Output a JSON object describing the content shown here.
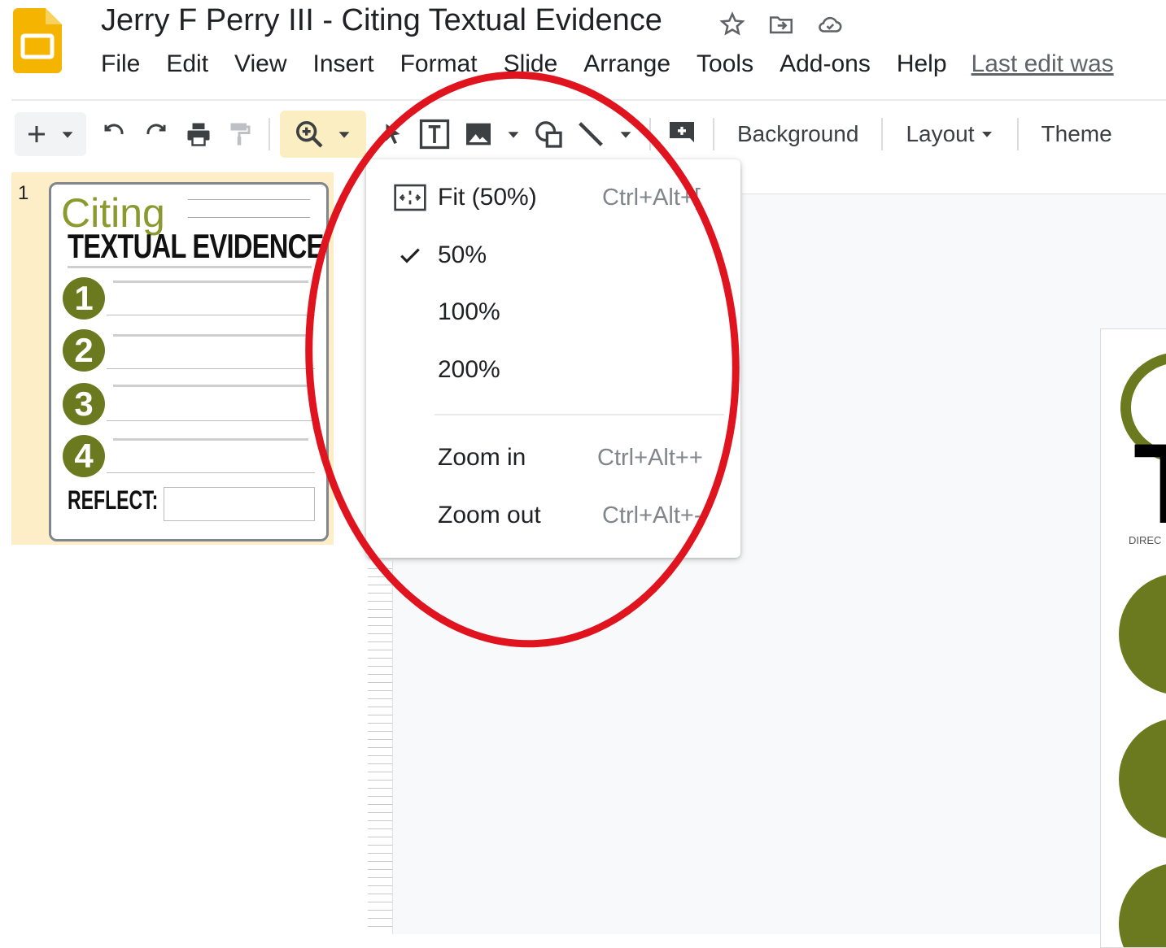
{
  "app": {
    "title": "Jerry F Perry III - Citing Textual Evidence",
    "brand_color": "#f4b400",
    "title_icons": [
      "star-icon",
      "move-to-folder-icon",
      "cloud-saved-icon"
    ]
  },
  "menu": {
    "items": [
      "File",
      "Edit",
      "View",
      "Insert",
      "Format",
      "Slide",
      "Arrange",
      "Tools",
      "Add-ons",
      "Help"
    ],
    "last_edit": "Last edit was"
  },
  "toolbar": {
    "icons": [
      "new-slide-icon",
      "undo-icon",
      "redo-icon",
      "print-icon",
      "paint-format-icon",
      "zoom-icon",
      "select-icon",
      "text-box-icon",
      "image-icon",
      "shape-icon",
      "line-icon",
      "comment-icon"
    ],
    "background_label": "Background",
    "layout_label": "Layout",
    "theme_label": "Theme"
  },
  "filmstrip": {
    "slide_number": "1",
    "thumbnail": {
      "heading_small": "Citing",
      "heading_large": "TEXTUAL EVIDENCE",
      "numbers": [
        "1",
        "2",
        "3",
        "4"
      ],
      "reflect": "REFLECT:"
    }
  },
  "zoom_menu": {
    "items": [
      {
        "label": "Fit (50%)",
        "shortcut": "Ctrl+Alt+[",
        "icon": "fit-icon",
        "checked": false
      },
      {
        "label": "50%",
        "shortcut": "",
        "icon": "",
        "checked": true
      },
      {
        "label": "100%",
        "shortcut": "",
        "icon": "",
        "checked": false
      },
      {
        "label": "200%",
        "shortcut": "",
        "icon": "",
        "checked": false
      },
      {
        "label": "Zoom in",
        "shortcut": "Ctrl+Alt++",
        "icon": "",
        "checked": false
      },
      {
        "label": "Zoom out",
        "shortcut": "Ctrl+Alt+-",
        "icon": "",
        "checked": false
      }
    ]
  },
  "canvas": {
    "partial_letters": "T",
    "partial_direction": "DIREC"
  },
  "annotation": {
    "color": "#e0141e",
    "shape": "ellipse-around-zoom-menu"
  },
  "colors": {
    "accent_green": "#6b7a1e",
    "selected_slide_bg": "#fdeec8"
  }
}
